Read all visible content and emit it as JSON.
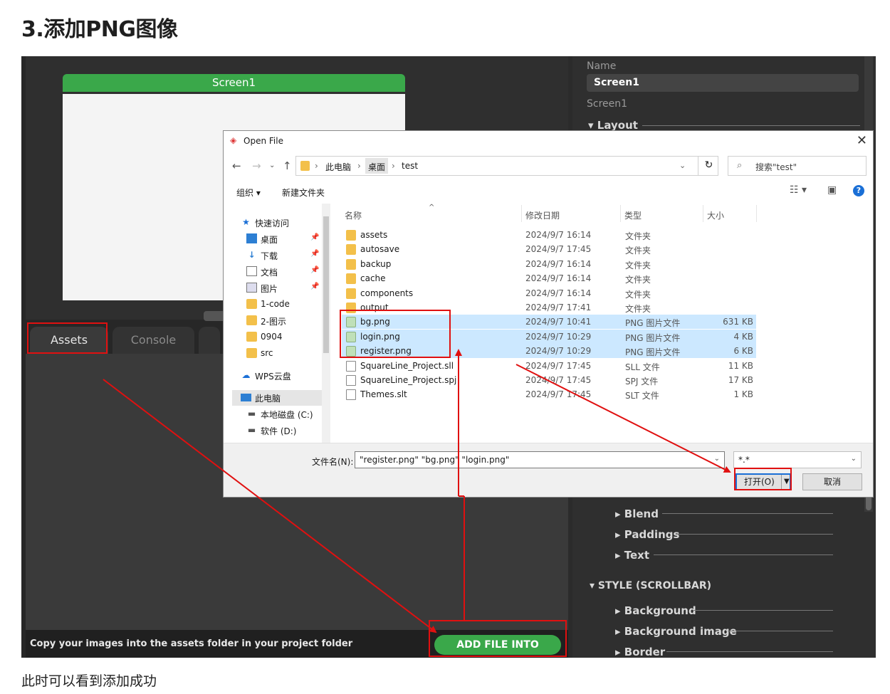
{
  "doc": {
    "title": "3.添加PNG图像",
    "footer": "此时可以看到添加成功"
  },
  "editor": {
    "screen_tab": "Screen1",
    "tabs": {
      "assets": "Assets",
      "console": "Console"
    },
    "bottom_hint": "Copy your images into the assets folder in your project folder",
    "add_button": "ADD FILE INTO ASSETS"
  },
  "inspector": {
    "name_label": "Name",
    "name_value": "Screen1",
    "subtitle": "Screen1",
    "layout": "Layout",
    "sections": [
      "Blend",
      "Paddings",
      "Text"
    ],
    "style_scrollbar": "STYLE (SCROLLBAR)",
    "scroll_sections": [
      "Background",
      "Background image",
      "Border"
    ]
  },
  "dialog": {
    "title": "Open File",
    "path": [
      "此电脑",
      "桌面",
      "test"
    ],
    "search_placeholder": "搜索\"test\"",
    "toolbar": {
      "organize": "组织 ▾",
      "new_folder": "新建文件夹"
    },
    "sidebar": [
      {
        "label": "快速访问",
        "icon": "star-icon"
      },
      {
        "label": "桌面",
        "icon": "desktop-icon",
        "pinned": true
      },
      {
        "label": "下载",
        "icon": "download-icon",
        "pinned": true
      },
      {
        "label": "文档",
        "icon": "document-icon",
        "pinned": true
      },
      {
        "label": "图片",
        "icon": "picture-icon",
        "pinned": true
      },
      {
        "label": "1-code",
        "icon": "folder-icon"
      },
      {
        "label": "2-图示",
        "icon": "folder-icon"
      },
      {
        "label": "0904",
        "icon": "folder-icon"
      },
      {
        "label": "src",
        "icon": "folder-icon"
      },
      {
        "label": "WPS云盘",
        "icon": "cloud-icon"
      },
      {
        "label": "此电脑",
        "icon": "computer-icon",
        "selected": true
      },
      {
        "label": "本地磁盘 (C:)",
        "icon": "drive-icon"
      },
      {
        "label": "软件 (D:)",
        "icon": "drive-icon"
      }
    ],
    "columns": {
      "name": "名称",
      "date": "修改日期",
      "type": "类型",
      "size": "大小"
    },
    "files": [
      {
        "name": "assets",
        "date": "2024/9/7 16:14",
        "type": "文件夹",
        "size": "",
        "kind": "folder"
      },
      {
        "name": "autosave",
        "date": "2024/9/7 17:45",
        "type": "文件夹",
        "size": "",
        "kind": "folder"
      },
      {
        "name": "backup",
        "date": "2024/9/7 16:14",
        "type": "文件夹",
        "size": "",
        "kind": "folder"
      },
      {
        "name": "cache",
        "date": "2024/9/7 16:14",
        "type": "文件夹",
        "size": "",
        "kind": "folder"
      },
      {
        "name": "components",
        "date": "2024/9/7 16:14",
        "type": "文件夹",
        "size": "",
        "kind": "folder"
      },
      {
        "name": "output",
        "date": "2024/9/7 17:41",
        "type": "文件夹",
        "size": "",
        "kind": "folder"
      },
      {
        "name": "bg.png",
        "date": "2024/9/7 10:41",
        "type": "PNG 图片文件",
        "size": "631 KB",
        "kind": "image",
        "selected": true
      },
      {
        "name": "login.png",
        "date": "2024/9/7 10:29",
        "type": "PNG 图片文件",
        "size": "4 KB",
        "kind": "image",
        "selected": true
      },
      {
        "name": "register.png",
        "date": "2024/9/7 10:29",
        "type": "PNG 图片文件",
        "size": "6 KB",
        "kind": "image",
        "selected": true
      },
      {
        "name": "SquareLine_Project.sll",
        "date": "2024/9/7 17:45",
        "type": "SLL 文件",
        "size": "11 KB",
        "kind": "doc"
      },
      {
        "name": "SquareLine_Project.spj",
        "date": "2024/9/7 17:45",
        "type": "SPJ 文件",
        "size": "17 KB",
        "kind": "doc"
      },
      {
        "name": "Themes.slt",
        "date": "2024/9/7 17:45",
        "type": "SLT 文件",
        "size": "1 KB",
        "kind": "doc"
      }
    ],
    "filename_label": "文件名(N):",
    "filename_value": "\"register.png\" \"bg.png\" \"login.png\"",
    "filter_value": "*.*",
    "open_button": "打开(O)",
    "cancel_button": "取消"
  },
  "colors": {
    "annotation": "#e01010",
    "accent_green": "#3aa84a",
    "selection": "#cce8ff"
  }
}
